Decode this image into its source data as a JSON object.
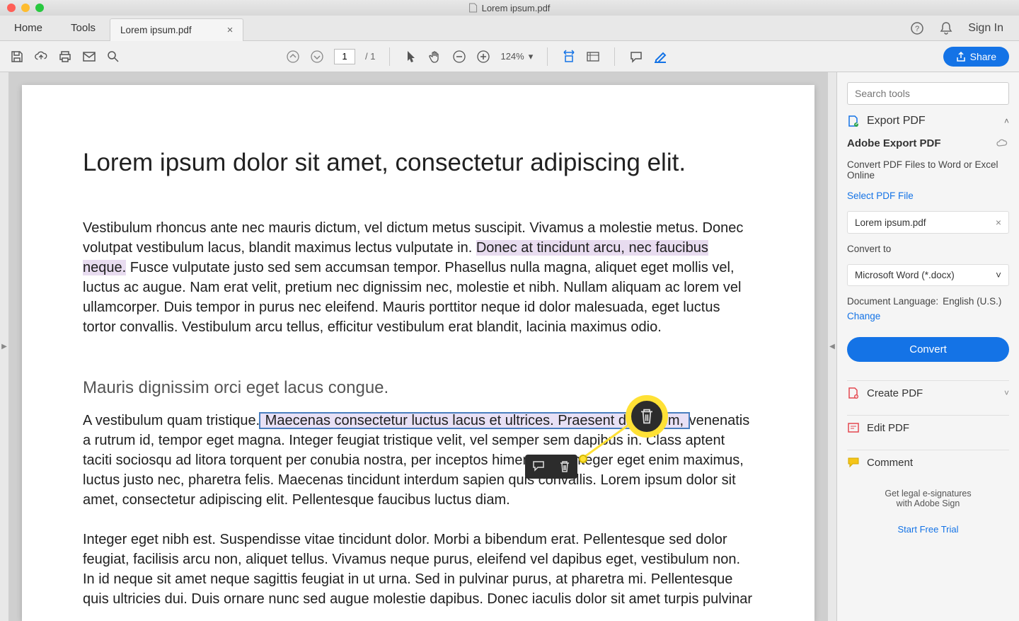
{
  "window": {
    "title": "Lorem ipsum.pdf"
  },
  "menubar": {
    "home": "Home",
    "tools": "Tools",
    "doc_tab": "Lorem ipsum.pdf",
    "sign_in": "Sign In"
  },
  "toolbar": {
    "page_current": "1",
    "page_total": "/ 1",
    "zoom": "124%",
    "share": "Share"
  },
  "document": {
    "h1": "Lorem ipsum dolor sit amet, consectetur adipiscing elit.",
    "p1a": "Vestibulum rhoncus ante nec mauris dictum, vel dictum metus suscipit. Vivamus a molestie metus. Donec volutpat vestibulum lacus, blandit maximus lectus vulputate in. ",
    "p1_hl": "Donec at tincidunt arcu, nec faucibus neque.",
    "p1b": " Fusce vulputate justo sed sem accumsan tempor. Phasellus nulla magna, aliquet eget mollis vel, luctus ac augue. Nam erat velit, pretium nec dignissim nec, molestie et nibh. Nullam aliquam ac lorem vel ullamcorper. Duis tempor in purus nec eleifend. Mauris porttitor neque id dolor malesuada, eget luctus tortor convallis. Vestibulum arcu tellus, efficitur vestibulum erat blandit, lacinia maximus odio.",
    "h2": "Mauris dignissim orci eget lacus congue.",
    "p2a": "A vestibulum quam tristique.",
    "p2_sel": " Maecenas consectetur luctus lacus et ultrices. Praesent diam sem, ",
    "p2b": "venenatis a rutrum id, tempor eget magna. Integer feugiat tristique velit, vel semper sem dapibus in. Class aptent taciti sociosqu ad litora torquent per conubia nostra, per inceptos himenaeos. Integer eget enim maximus, luctus justo nec, pharetra felis. Maecenas tincidunt interdum sapien quis convallis. Lorem ipsum dolor sit amet, consectetur adipiscing elit. Pellentesque faucibus luctus diam.",
    "p3": "Integer eget nibh est. Suspendisse vitae tincidunt dolor. Morbi a bibendum erat. Pellentesque sed dolor feugiat, facilisis arcu non, aliquet tellus. Vivamus neque purus, eleifend vel dapibus eget, vestibulum non. In id neque sit amet neque sagittis feugiat in ut urna. Sed in pulvinar purus, at pharetra mi. Pellentesque quis ultricies dui. Duis ornare nunc sed augue molestie dapibus. Donec iaculis dolor sit amet turpis pulvinar"
  },
  "sidebar": {
    "search_placeholder": "Search tools",
    "export_pdf": "Export PDF",
    "export_title": "Adobe Export PDF",
    "export_sub": "Convert PDF Files to Word or Excel Online",
    "select_file": "Select PDF File",
    "selected_file": "Lorem ipsum.pdf",
    "convert_to_label": "Convert to",
    "convert_to_value": "Microsoft Word (*.docx)",
    "doc_lang_label": "Document Language:",
    "doc_lang_value": "English (U.S.)",
    "change": "Change",
    "convert_btn": "Convert",
    "create_pdf": "Create PDF",
    "edit_pdf": "Edit PDF",
    "comment": "Comment",
    "promo1": "Get legal e-signatures",
    "promo2": "with Adobe Sign",
    "start_trial": "Start Free Trial"
  }
}
